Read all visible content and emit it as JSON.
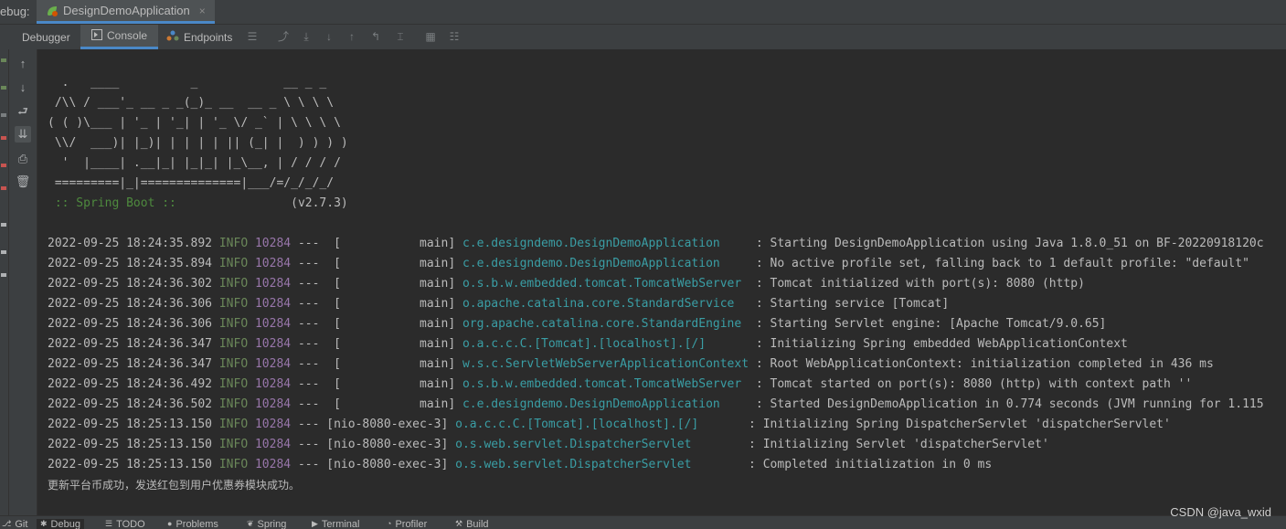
{
  "tabbar": {
    "prefix": "ebug:",
    "run_config": "DesignDemoApplication",
    "close_glyph": "×"
  },
  "toolbar": {
    "tabs": [
      {
        "label": "Debugger",
        "icon": ""
      },
      {
        "label": "Console",
        "icon": "console-icon"
      },
      {
        "label": "Endpoints",
        "icon": "endpoints-icon"
      }
    ]
  },
  "banner": [
    "  .   ____          _            __ _ _",
    " /\\\\ / ___'_ __ _ _(_)_ __  __ _ \\ \\ \\ \\",
    "( ( )\\___ | '_ | '_| | '_ \\/ _` | \\ \\ \\ \\",
    " \\\\/  ___)| |_)| | | | | || (_| |  ) ) ) )",
    "  '  |____| .__|_| |_|_| |_\\__, | / / / /",
    " =========|_|==============|___/=/_/_/_/"
  ],
  "spring_boot": {
    "label": " :: Spring Boot :: ",
    "version": "               (v2.7.3)"
  },
  "log_lines": [
    {
      "ts": "2022-09-25 18:24:35.892",
      "level": "INFO",
      "pid": "10284",
      "thread": "---  [           main]",
      "logger": "c.e.designdemo.DesignDemoApplication    ",
      "msg": " : Starting DesignDemoApplication using Java 1.8.0_51 on BF-20220918120c"
    },
    {
      "ts": "2022-09-25 18:24:35.894",
      "level": "INFO",
      "pid": "10284",
      "thread": "---  [           main]",
      "logger": "c.e.designdemo.DesignDemoApplication    ",
      "msg": " : No active profile set, falling back to 1 default profile: \"default\""
    },
    {
      "ts": "2022-09-25 18:24:36.302",
      "level": "INFO",
      "pid": "10284",
      "thread": "---  [           main]",
      "logger": "o.s.b.w.embedded.tomcat.TomcatWebServer ",
      "msg": " : Tomcat initialized with port(s): 8080 (http)"
    },
    {
      "ts": "2022-09-25 18:24:36.306",
      "level": "INFO",
      "pid": "10284",
      "thread": "---  [           main]",
      "logger": "o.apache.catalina.core.StandardService  ",
      "msg": " : Starting service [Tomcat]"
    },
    {
      "ts": "2022-09-25 18:24:36.306",
      "level": "INFO",
      "pid": "10284",
      "thread": "---  [           main]",
      "logger": "org.apache.catalina.core.StandardEngine ",
      "msg": " : Starting Servlet engine: [Apache Tomcat/9.0.65]"
    },
    {
      "ts": "2022-09-25 18:24:36.347",
      "level": "INFO",
      "pid": "10284",
      "thread": "---  [           main]",
      "logger": "o.a.c.c.C.[Tomcat].[localhost].[/]      ",
      "msg": " : Initializing Spring embedded WebApplicationContext"
    },
    {
      "ts": "2022-09-25 18:24:36.347",
      "level": "INFO",
      "pid": "10284",
      "thread": "---  [           main]",
      "logger": "w.s.c.ServletWebServerApplicationContext",
      "msg": " : Root WebApplicationContext: initialization completed in 436 ms"
    },
    {
      "ts": "2022-09-25 18:24:36.492",
      "level": "INFO",
      "pid": "10284",
      "thread": "---  [           main]",
      "logger": "o.s.b.w.embedded.tomcat.TomcatWebServer ",
      "msg": " : Tomcat started on port(s): 8080 (http) with context path ''"
    },
    {
      "ts": "2022-09-25 18:24:36.502",
      "level": "INFO",
      "pid": "10284",
      "thread": "---  [           main]",
      "logger": "c.e.designdemo.DesignDemoApplication    ",
      "msg": " : Started DesignDemoApplication in 0.774 seconds (JVM running for 1.115"
    },
    {
      "ts": "2022-09-25 18:25:13.150",
      "level": "INFO",
      "pid": "10284",
      "thread": "--- [nio-8080-exec-3]",
      "logger": "o.a.c.c.C.[Tomcat].[localhost].[/]      ",
      "msg": " : Initializing Spring DispatcherServlet 'dispatcherServlet'"
    },
    {
      "ts": "2022-09-25 18:25:13.150",
      "level": "INFO",
      "pid": "10284",
      "thread": "--- [nio-8080-exec-3]",
      "logger": "o.s.web.servlet.DispatcherServlet       ",
      "msg": " : Initializing Servlet 'dispatcherServlet'"
    },
    {
      "ts": "2022-09-25 18:25:13.150",
      "level": "INFO",
      "pid": "10284",
      "thread": "--- [nio-8080-exec-3]",
      "logger": "o.s.web.servlet.DispatcherServlet       ",
      "msg": " : Completed initialization in 0 ms"
    }
  ],
  "output_line": "更新平台币成功，发送红包到用户优惠券模块成功。",
  "bottombar": {
    "tabs": [
      {
        "label": "Git",
        "icon": "git-icon"
      },
      {
        "label": "Debug",
        "icon": "debug-icon"
      },
      {
        "label": "TODO",
        "icon": "todo-icon"
      },
      {
        "label": "Problems",
        "icon": "problems-icon"
      },
      {
        "label": "Spring",
        "icon": "spring-icon"
      },
      {
        "label": "Terminal",
        "icon": "terminal-icon"
      },
      {
        "label": "Profiler",
        "icon": "profiler-icon"
      },
      {
        "label": "Build",
        "icon": "build-icon"
      }
    ]
  },
  "watermark": "CSDN @java_wxid",
  "colors": {
    "background": "#2b2b2b",
    "panel": "#3c3f41",
    "accent": "#4a88c7",
    "info_level": "#6a8759",
    "pid": "#9876aa",
    "logger": "#3a9ea5",
    "spring_label": "#4e8a3e"
  }
}
